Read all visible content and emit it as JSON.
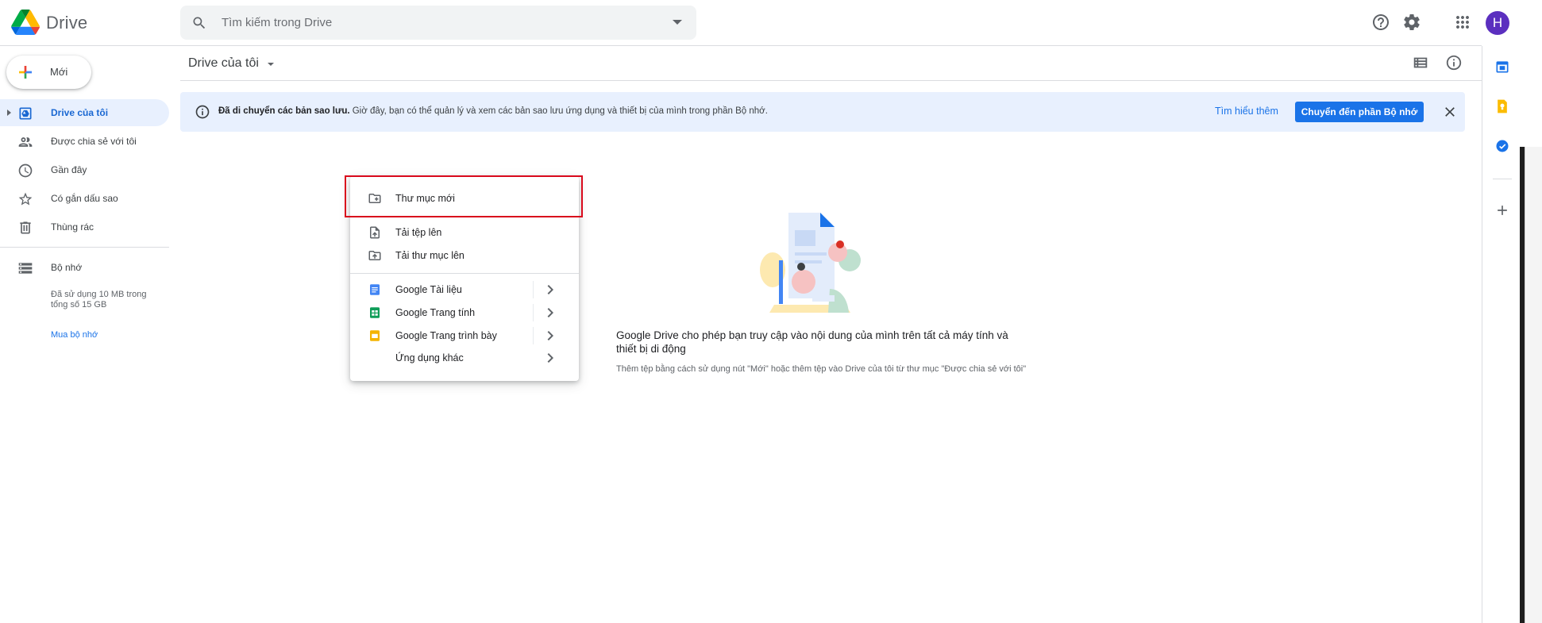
{
  "header": {
    "brand": "Drive",
    "search_placeholder": "Tìm kiếm trong Drive",
    "avatar_letter": "H"
  },
  "sidebar": {
    "new_label": "Mới",
    "items": [
      {
        "label": "Drive của tôi",
        "icon": "my-drive-icon",
        "active": true
      },
      {
        "label": "Được chia sẻ với tôi",
        "icon": "people-icon"
      },
      {
        "label": "Gần đây",
        "icon": "clock-icon"
      },
      {
        "label": "Có gắn dấu sao",
        "icon": "star-icon"
      },
      {
        "label": "Thùng rác",
        "icon": "trash-icon"
      }
    ],
    "storage": {
      "label": "Bộ nhớ",
      "usage_text": "Đã sử dụng 10 MB trong tổng số 15 GB",
      "buy_label": "Mua bộ nhớ"
    }
  },
  "main": {
    "breadcrumb": "Drive của tôi",
    "banner": {
      "bold": "Đã di chuyển các bản sao lưu.",
      "text": " Giờ đây, bạn có thể quản lý và xem các bản sao lưu ứng dụng và thiết bị của mình trong phần Bộ nhớ.",
      "learn_more": "Tìm hiểu thêm",
      "action": "Chuyển đến phần Bộ nhớ"
    },
    "empty_state": {
      "title": "Google Drive cho phép bạn truy cập vào nội dung của mình trên tất cả máy tính và thiết bị di động",
      "subtitle": "Thêm tệp bằng cách sử dụng nút \"Mới\" hoặc thêm tệp vào Drive của tôi từ thư mục \"Được chia sẻ với tôi\""
    }
  },
  "menu": {
    "new_folder": "Thư mục mới",
    "upload_file": "Tải tệp lên",
    "upload_folder": "Tải thư mục lên",
    "google_docs": "Google Tài liệu",
    "google_sheets": "Google Trang tính",
    "google_slides": "Google Trang trình bày",
    "more_apps": "Ứng dụng khác"
  },
  "colors": {
    "accent": "#1a73e8",
    "active_bg": "#e8f0fe",
    "highlight": "#d9091c",
    "avatar": "#5b2fbf"
  }
}
